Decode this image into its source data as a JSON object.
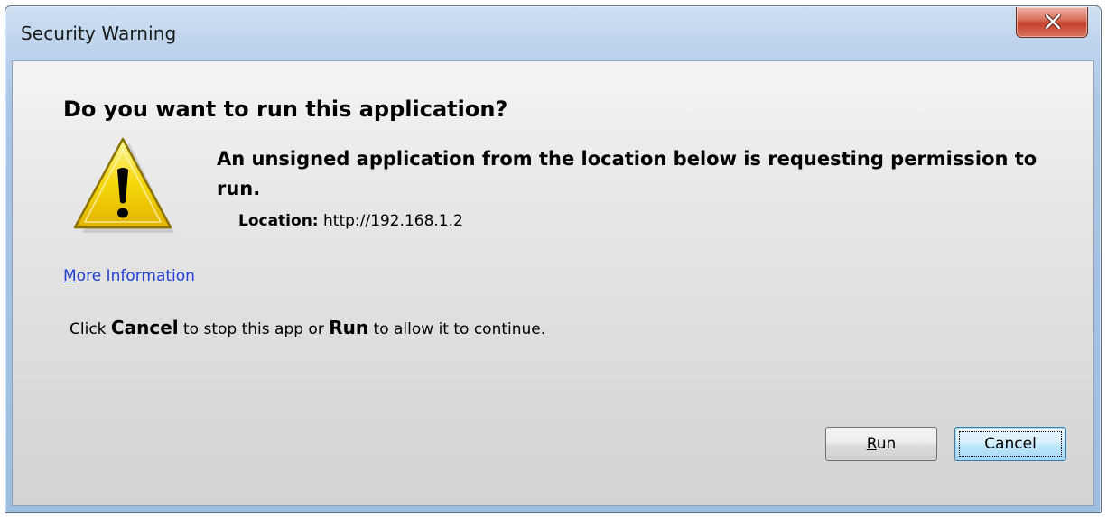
{
  "window": {
    "title": "Security Warning",
    "close_icon": "close-icon"
  },
  "dialog": {
    "heading": "Do you want to run this application?",
    "warning_icon": "warning-triangle-icon",
    "message": "An unsigned application from the location below is requesting permission to run.",
    "location_label": "Location:",
    "location_value": "http://192.168.1.2",
    "more_info_first": "M",
    "more_info_rest": "ore Information",
    "instruction_prefix": "Click",
    "instruction_cancel": "Cancel",
    "instruction_middle": "to stop this app or",
    "instruction_run": "Run",
    "instruction_suffix": "to allow it to continue."
  },
  "buttons": {
    "run_mnemonic": "R",
    "run_rest": "un",
    "cancel_label": "Cancel"
  },
  "colors": {
    "title_bar": "#aac6e6",
    "close_button": "#c6432c",
    "link": "#1f3fd6",
    "warning_yellow": "#f5d80a"
  }
}
